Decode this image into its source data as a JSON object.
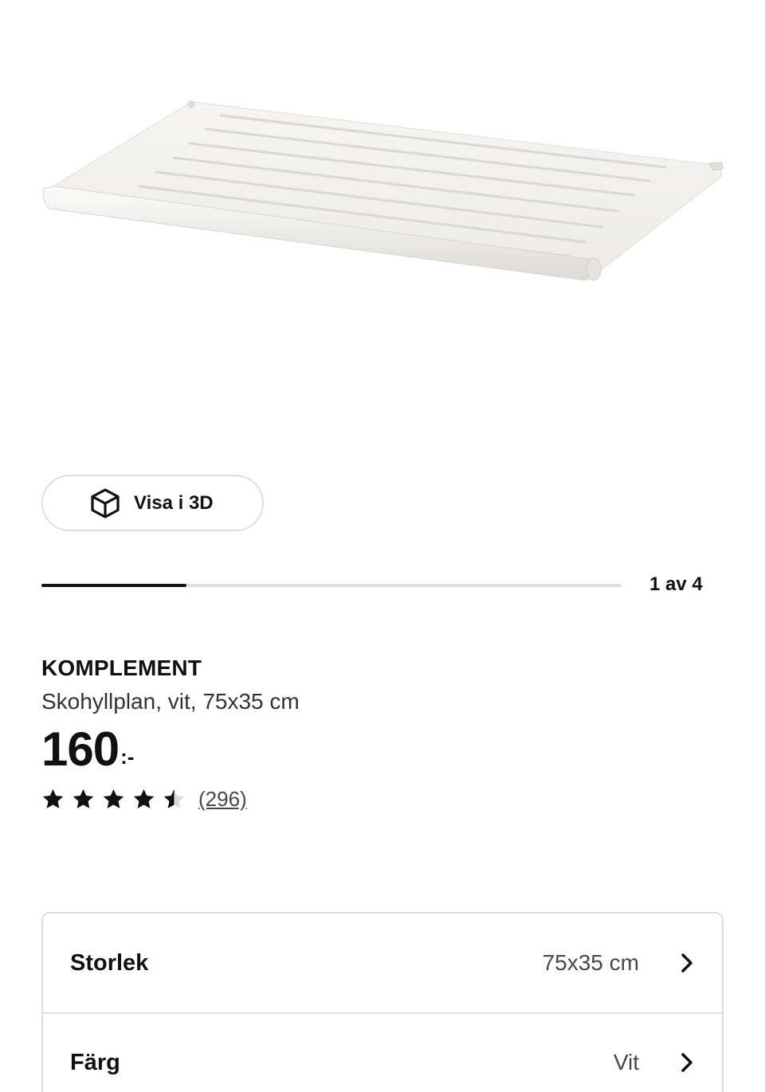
{
  "gallery": {
    "view_3d_label": "Visa i 3D",
    "position_label": "1 av 4",
    "progress_fraction": 0.25
  },
  "product": {
    "brand": "KOMPLEMENT",
    "description": "Skohyllplan, vit, 75x35 cm",
    "price": "160",
    "price_suffix": ":-",
    "rating": 4.5,
    "rating_max": 5,
    "review_count": "(296)"
  },
  "options": [
    {
      "label": "Storlek",
      "value": "75x35 cm"
    },
    {
      "label": "Färg",
      "value": "Vit"
    }
  ],
  "icons": {
    "view_3d": "cube-icon",
    "star": "star-icon",
    "chevron": "chevron-right-icon"
  },
  "colors": {
    "text": "#111111",
    "muted": "#484848",
    "border": "#dfdfdf",
    "progress_fill": "#111111",
    "progress_track": "#dfdfdf"
  }
}
